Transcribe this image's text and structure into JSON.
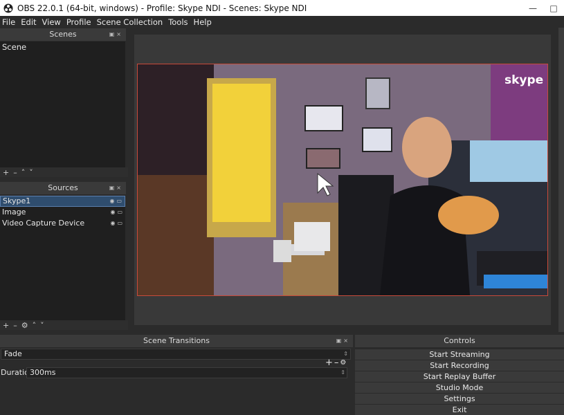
{
  "window": {
    "title": "OBS 22.0.1 (64-bit, windows) - Profile: Skype NDI - Scenes: Skype NDI"
  },
  "menu": [
    "File",
    "Edit",
    "View",
    "Profile",
    "Scene Collection",
    "Tools",
    "Help"
  ],
  "scenes": {
    "title": "Scenes",
    "items": [
      "Scene"
    ]
  },
  "sources": {
    "title": "Sources",
    "items": [
      {
        "label": "Skype1",
        "selected": true
      },
      {
        "label": "Image",
        "selected": false
      },
      {
        "label": "Video Capture Device",
        "selected": false
      }
    ]
  },
  "preview": {
    "watermark": "skype"
  },
  "transitions": {
    "title": "Scene Transitions",
    "selected": "Fade",
    "duration_label": "Duration",
    "duration_value": "300ms"
  },
  "controls": {
    "title": "Controls",
    "buttons": [
      "Start Streaming",
      "Start Recording",
      "Start Replay Buffer",
      "Studio Mode",
      "Settings",
      "Exit"
    ]
  },
  "colors": {
    "background": "#2b2b2b",
    "selection": "#2f4d6e",
    "preview_border": "#c94a3a"
  }
}
